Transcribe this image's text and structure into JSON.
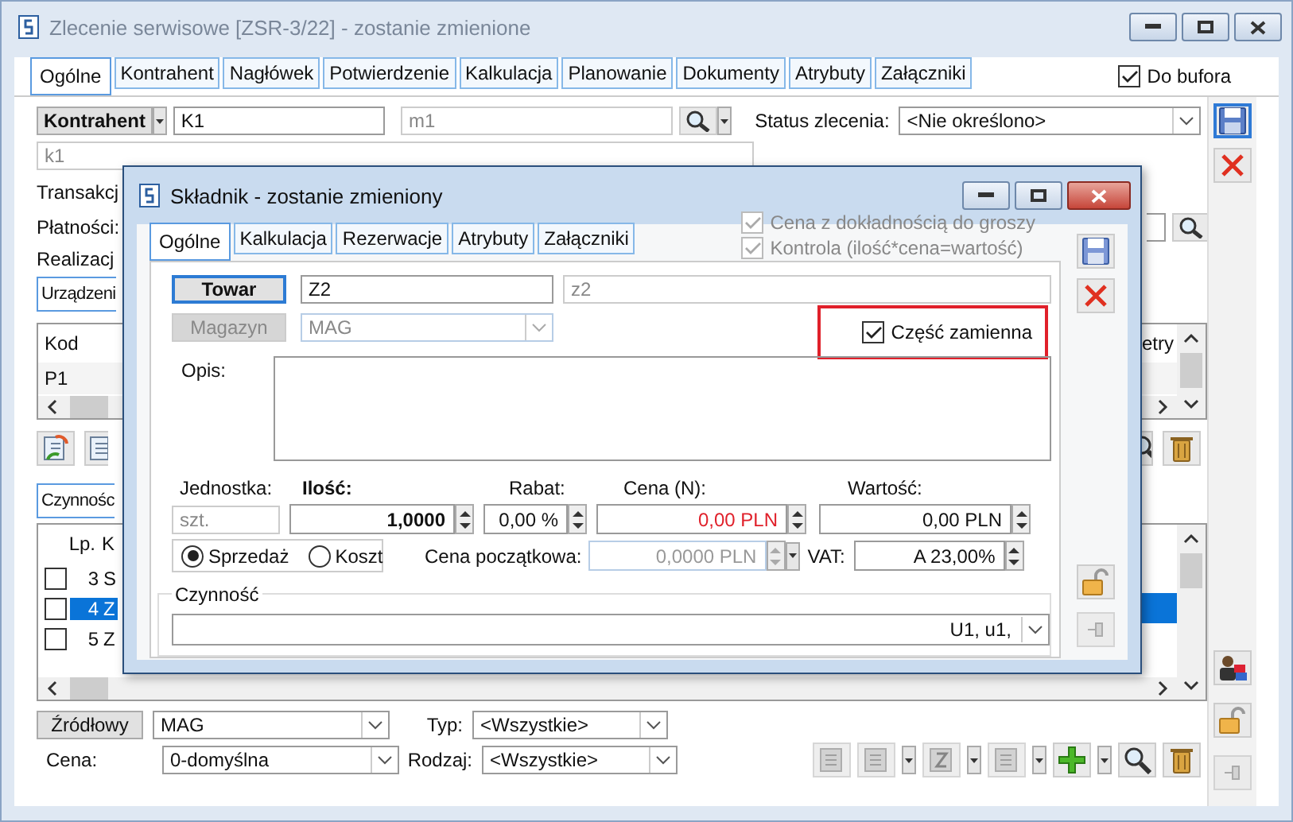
{
  "window": {
    "title": "Zlecenie serwisowe [ZSR-3/22]  - zostanie zmienione"
  },
  "tabs": [
    {
      "label": "Ogólne",
      "selected": true
    },
    {
      "label": "Kontrahent",
      "selected": false
    },
    {
      "label": "Nagłówek",
      "selected": false
    },
    {
      "label": "Potwierdzenie",
      "selected": false
    },
    {
      "label": "Kalkulacja",
      "selected": false
    },
    {
      "label": "Planowanie",
      "selected": false
    },
    {
      "label": "Dokumenty",
      "selected": false
    },
    {
      "label": "Atrybuty",
      "selected": false
    },
    {
      "label": "Załączniki",
      "selected": false
    }
  ],
  "do_bufora": {
    "label": "Do bufora",
    "checked": true
  },
  "kontrahent": {
    "button": "Kontrahent",
    "code": "K1",
    "name": "m1",
    "detail": "k1"
  },
  "status": {
    "label": "Status zlecenia:",
    "value": "<Nie określono>"
  },
  "left_labels": [
    "Transakcj",
    "Płatności:",
    "Realizacj"
  ],
  "devices": {
    "tab": "Urządzeni",
    "columns": [
      "Kod",
      "etry"
    ],
    "rows": [
      [
        "P1"
      ]
    ]
  },
  "activities": {
    "tab": "Czynnośc",
    "columns": [
      "Lp.",
      "K"
    ],
    "rows": [
      {
        "lp": "3",
        "code": "S",
        "checked": false,
        "selected": false
      },
      {
        "lp": "4",
        "code": "Z",
        "checked": false,
        "selected": true
      },
      {
        "lp": "5",
        "code": "Z",
        "checked": false,
        "selected": false
      }
    ]
  },
  "source": {
    "button": "Źródłowy",
    "warehouse": "MAG",
    "price_label": "Cena:",
    "price": "0-domyślna",
    "type_label": "Typ:",
    "type": "<Wszystkie>",
    "kind_label": "Rodzaj:",
    "kind": "<Wszystkie>"
  },
  "dialog": {
    "title": "Składnik - zostanie zmieniony",
    "tabs": [
      {
        "label": "Ogólne",
        "selected": true
      },
      {
        "label": "Kalkulacja",
        "selected": false
      },
      {
        "label": "Rezerwacje",
        "selected": false
      },
      {
        "label": "Atrybuty",
        "selected": false
      },
      {
        "label": "Załączniki",
        "selected": false
      }
    ],
    "options": [
      {
        "label": "Cena z dokładnością do groszy",
        "checked": true,
        "disabled": true
      },
      {
        "label": "Kontrola (ilość*cena=wartość)",
        "checked": true,
        "disabled": true
      }
    ],
    "towar": {
      "button": "Towar",
      "code": "Z2",
      "name": "z2"
    },
    "magazyn": {
      "button": "Magazyn",
      "value": "MAG",
      "disabled": true
    },
    "spare_part": {
      "label": "Część zamienna",
      "checked": true
    },
    "opis_label": "Opis:",
    "labels": {
      "unit": "Jednostka:",
      "qty": "Ilość:",
      "discount": "Rabat:",
      "price": "Cena (N):",
      "value": "Wartość:"
    },
    "unit": "szt.",
    "qty": "1,0000",
    "discount": "0,00 %",
    "price": "0,00 PLN",
    "value": "0,00 PLN",
    "mode": [
      {
        "label": "Sprzedaż",
        "selected": true
      },
      {
        "label": "Koszt",
        "selected": false
      }
    ],
    "start_price_label": "Cena początkowa:",
    "start_price": "0,0000 PLN",
    "vat_label": "VAT:",
    "vat": "A 23,00%",
    "activity_label": "Czynność",
    "activity": "U1, u1,"
  }
}
